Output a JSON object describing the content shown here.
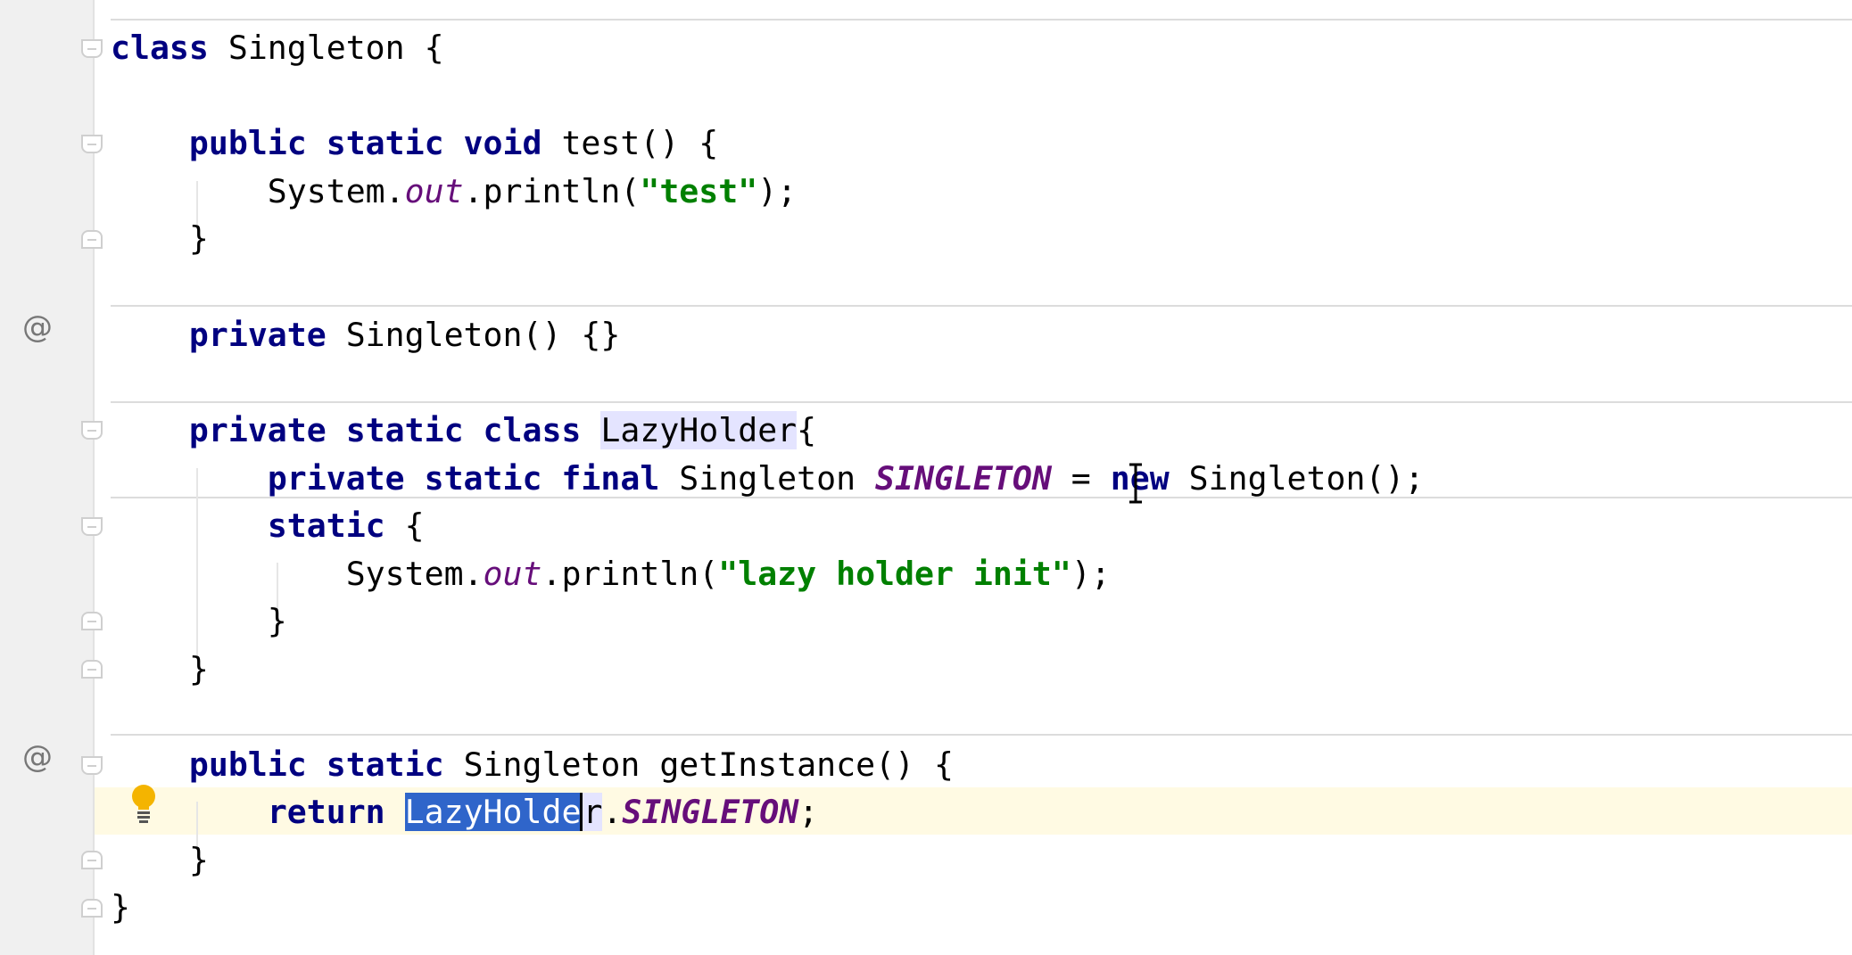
{
  "editor": {
    "language": "java",
    "gutter_marks": {
      "override_1": "@",
      "override_2": "@"
    },
    "lines": {
      "l1": [
        "class",
        " Singleton {"
      ],
      "l3": [
        "    ",
        "public static void",
        " test() {"
      ],
      "l4": [
        "        System.",
        "out",
        ".println(",
        "\"test\"",
        ");"
      ],
      "l5": [
        "    }"
      ],
      "l7": [
        "    ",
        "private",
        " Singleton() {}"
      ],
      "l9": [
        "    ",
        "private static class",
        " ",
        "LazyHolder",
        "{"
      ],
      "l10": [
        "        ",
        "private static final",
        " Singleton ",
        "SINGLETON",
        " = ",
        "n",
        "ew",
        " Singleton();"
      ],
      "l11": [
        "        ",
        "static",
        " {"
      ],
      "l12": [
        "            System.",
        "out",
        ".println(",
        "\"lazy holder init\"",
        ");"
      ],
      "l13": [
        "        }"
      ],
      "l14": [
        "    }"
      ],
      "l16": [
        "    ",
        "public static",
        " Singleton getInstance() {"
      ],
      "l17": [
        "        ",
        "return",
        " ",
        "LazyHolde",
        "r",
        ".",
        "SINGLETON",
        ";"
      ],
      "l18": [
        "    }"
      ],
      "l19": [
        "}"
      ]
    },
    "icons": {
      "intention": "lightbulb-icon",
      "cursor": "text-cursor-icon"
    },
    "colors": {
      "keyword": "#000080",
      "string": "#008000",
      "static_field": "#660e7a",
      "selection": "#2f65ca",
      "caret_row": "#fffae3"
    }
  }
}
